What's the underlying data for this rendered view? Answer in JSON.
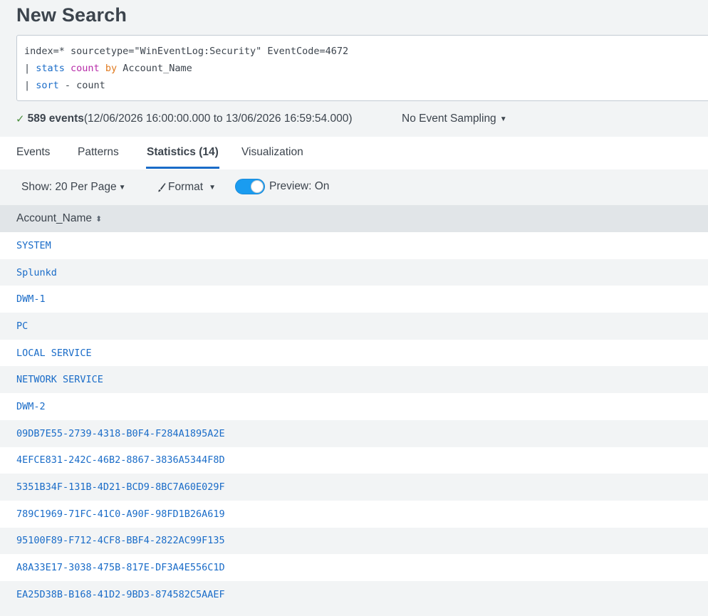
{
  "page": {
    "title": "New Search"
  },
  "query": {
    "line1": "index=* sourcetype=\"WinEventLog:Security\" EventCode=4672",
    "line2": {
      "pipe": "| ",
      "cmd": "stats",
      "sp1": " ",
      "fn": "count",
      "sp2": " ",
      "by": "by",
      "rest": " Account_Name"
    },
    "line3": {
      "pipe": "| ",
      "cmd": "sort",
      "rest": " - count"
    }
  },
  "status": {
    "check": "✓",
    "count": "589 events",
    "range": " (12/06/2026 16:00:00.000 to 13/06/2026 16:59:54.000)",
    "sampling": "No Event Sampling"
  },
  "tabs": [
    {
      "label": "Events"
    },
    {
      "label": "Patterns"
    },
    {
      "label": "Statistics (14)",
      "active": true
    },
    {
      "label": "Visualization"
    }
  ],
  "controls": {
    "show": "Show: 20 Per Page",
    "format": "Format",
    "preview": "Preview: On"
  },
  "table": {
    "header": "Account_Name",
    "rows": [
      "SYSTEM",
      "Splunkd",
      "DWM-1",
      "PC",
      "LOCAL SERVICE",
      "NETWORK SERVICE",
      "DWM-2",
      "09DB7E55-2739-4318-B0F4-F284A1895A2E",
      "4EFCE831-242C-46B2-8867-3836A5344F8D",
      "5351B34F-131B-4D21-BCD9-8BC7A60E029F",
      "789C1969-71FC-41C0-A90F-98FD1B26A619",
      "95100F89-F712-4CF8-BBF4-2822AC99F135",
      "A8A33E17-3038-475B-817E-DF3A4E556C1D",
      "EA25D38B-B168-41D2-9BD3-874582C5AAEF"
    ]
  },
  "colors": {
    "accent": "#1a6cc8",
    "toggle": "#1a9cf0",
    "success": "#4b8f3d"
  },
  "icons": {
    "check": "check-icon",
    "caret": "caret-down-icon",
    "brush": "brush-icon",
    "sort": "sort-icon"
  }
}
